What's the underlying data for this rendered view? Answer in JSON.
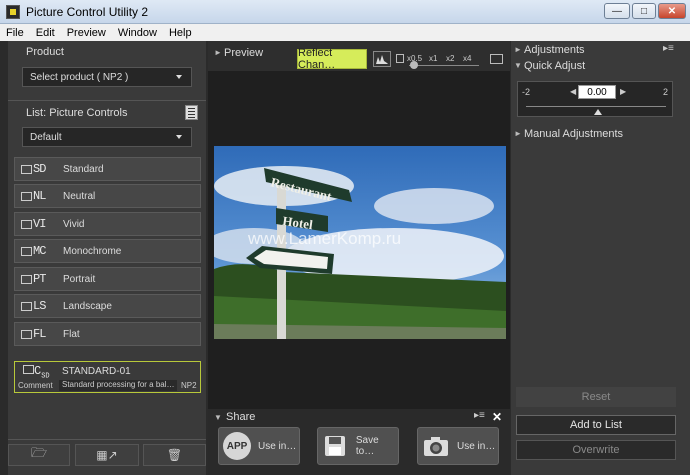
{
  "window": {
    "title": "Picture Control Utility 2"
  },
  "menu": [
    "File",
    "Edit",
    "Preview",
    "Window",
    "Help"
  ],
  "product": {
    "header": "Product",
    "selected": "Select product ( NP2 )"
  },
  "list": {
    "header": "List: Picture Controls",
    "filter": "Default"
  },
  "picture_controls": [
    {
      "code": "SD",
      "name": "Standard"
    },
    {
      "code": "NL",
      "name": "Neutral"
    },
    {
      "code": "VI",
      "name": "Vivid"
    },
    {
      "code": "MC",
      "name": "Monochrome"
    },
    {
      "code": "PT",
      "name": "Portrait"
    },
    {
      "code": "LS",
      "name": "Landscape"
    },
    {
      "code": "FL",
      "name": "Flat"
    }
  ],
  "custom_control": {
    "base": "SD",
    "name": "STANDARD-01",
    "comment_label": "Comment",
    "comment": "Standard processing for a bal…",
    "device": "NP2"
  },
  "preview": {
    "header": "Preview",
    "reflect_button": "Reflect Chan…",
    "zoom_options": [
      "x0.5",
      "x1",
      "x2",
      "x4"
    ],
    "signs": [
      "Restaurant",
      "Hotel"
    ],
    "watermark": "www.LamerKomp.ru"
  },
  "share": {
    "header": "Share",
    "buttons": [
      {
        "icon": "APP",
        "label": "Use in…"
      },
      {
        "label": "Save to…"
      },
      {
        "label": "Use in…"
      }
    ]
  },
  "adjustments": {
    "header": "Adjustments",
    "quick_adjust": {
      "header": "Quick Adjust",
      "min": "-2",
      "max": "2",
      "value": "0.00"
    },
    "manual": "Manual Adjustments",
    "reset": "Reset",
    "add_to_list": "Add to List",
    "overwrite": "Overwrite"
  },
  "colors": {
    "accent": "#d6ec5a",
    "selection": "#b8c93a",
    "panel": "#3a3a3a"
  }
}
